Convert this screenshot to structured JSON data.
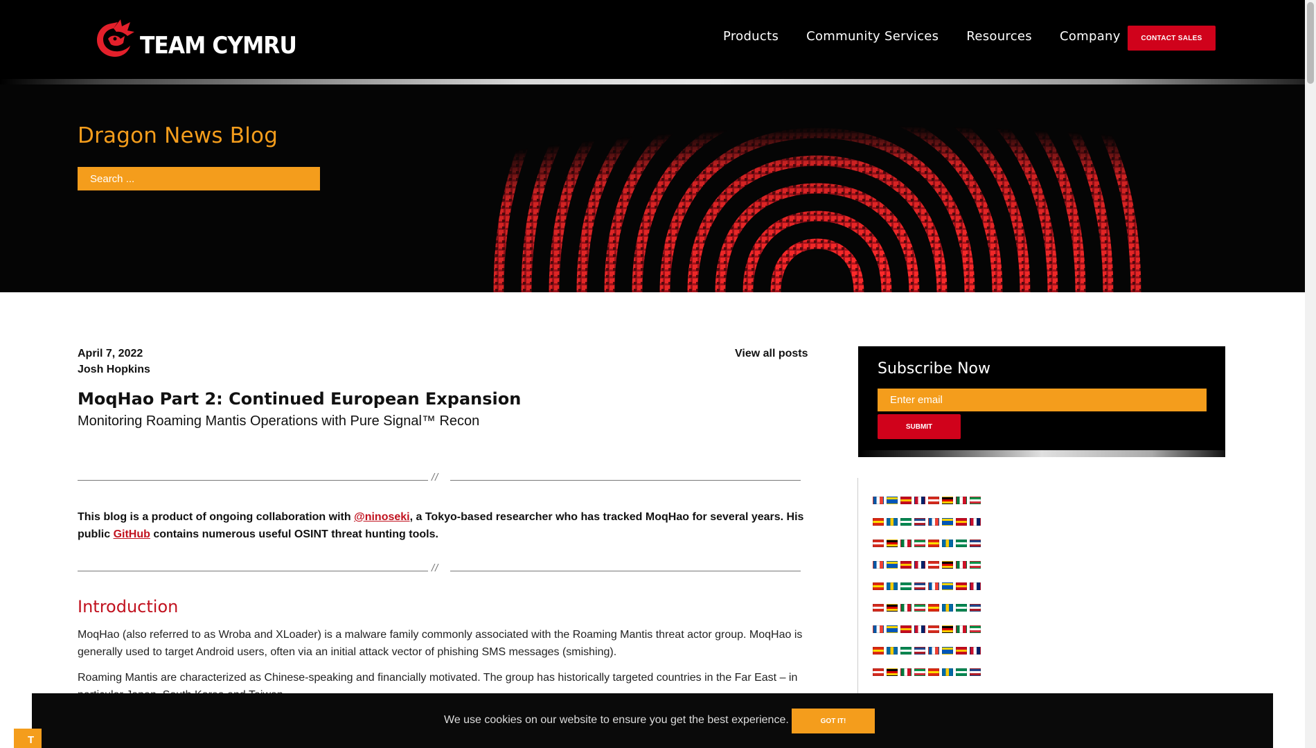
{
  "brand": {
    "name": "TEAM CYMRU",
    "accent": "#d0021b",
    "orange": "#f49d1c"
  },
  "nav": {
    "items": [
      "Products",
      "Community Services",
      "Resources",
      "Company"
    ],
    "contact": "CONTACT SALES"
  },
  "hero": {
    "title": "Dragon News Blog",
    "search_placeholder": "Search ..."
  },
  "post": {
    "date": "April 7, 2022",
    "author": "Josh Hopkins",
    "view_all": "View all posts",
    "title": "MoqHao Part 2: Continued European Expansion",
    "subtitle": "Monitoring Roaming Mantis Operations with Pure Signal™ Recon",
    "intro_before": "This blog is a product of ongoing collaboration with ",
    "intro_link1": "@ninoseki",
    "intro_middle": ", a Tokyo-based researcher who has tracked MoqHao for several years. His public ",
    "intro_link2": "GitHub",
    "intro_after": " contains numerous useful OSINT threat hunting tools.",
    "section_heading": "Introduction",
    "p1": "MoqHao (also referred to as Wroba and XLoader) is a malware family commonly associated with the Roaming Mantis threat actor group. MoqHao is generally used to target Android users, often via an initial attack vector of phishing SMS messages (smishing).",
    "p2": "Roaming Mantis are characterized as Chinese-speaking and financially motivated. The group has historically targeted countries in the Far East – in particular Japan, South Korea and Taiwan."
  },
  "subscribe": {
    "title": "Subscribe Now",
    "placeholder": "Enter email",
    "button": "SUBMIT"
  },
  "cookie": {
    "text": "We use cookies on our website to ensure you get the best experience.",
    "button": "GOT IT!"
  },
  "translate_tab": "T",
  "flags_icon": "language-flag-icon"
}
